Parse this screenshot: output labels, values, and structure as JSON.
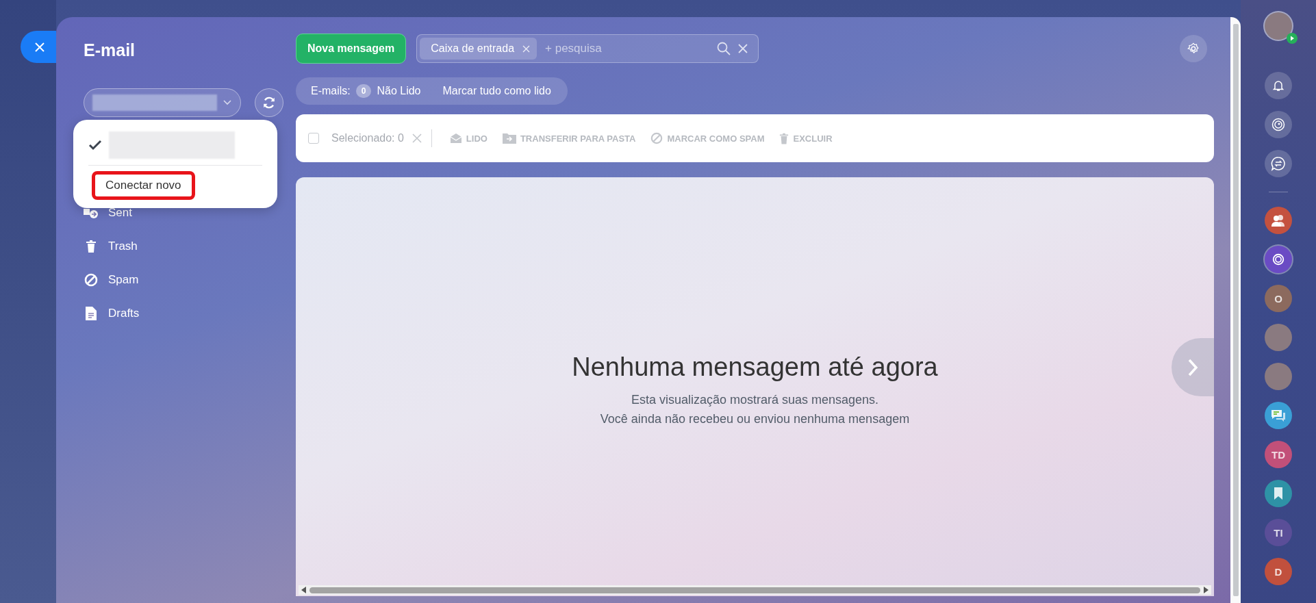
{
  "sidebar": {
    "title": "E-mail",
    "account_menu": [
      {
        "kind": "account",
        "checked": true
      },
      {
        "kind": "action",
        "label": "Conectar novo",
        "highlighted": true
      }
    ],
    "folders": [
      {
        "kind": "sent",
        "label": "Sent"
      },
      {
        "kind": "trash",
        "label": "Trash"
      },
      {
        "kind": "spam",
        "label": "Spam"
      },
      {
        "kind": "drafts",
        "label": "Drafts"
      }
    ]
  },
  "toolbar": {
    "new_button": "Nova mensagem",
    "search": {
      "chip": "Caixa de entrada",
      "placeholder": "+ pesquisa"
    }
  },
  "counters": {
    "label": "E-mails:",
    "count": "0",
    "count_label": "Não Lido",
    "mark_all": "Marcar tudo como lido"
  },
  "actions": {
    "checked": false,
    "selected_label": "Selecionado: 0",
    "items": [
      {
        "kind": "read",
        "label": "LIDO"
      },
      {
        "kind": "move",
        "label": "TRANSFERIR PARA PASTA"
      },
      {
        "kind": "spam",
        "label": "MARCAR COMO SPAM"
      },
      {
        "kind": "delete",
        "label": "EXCLUIR"
      }
    ]
  },
  "empty_state": {
    "title": "Nenhuma mensagem até agora",
    "lines": [
      "Esta visualização mostrará suas mensagens.",
      "Você ainda não recebeu ou enviou nenhuma mensagem"
    ]
  },
  "right_rail": [
    {
      "kind": "profile"
    },
    {
      "kind": "bell"
    },
    {
      "kind": "copilot"
    },
    {
      "kind": "chat-switch"
    },
    {
      "kind": "divider"
    },
    {
      "kind": "group",
      "color": "#c4513f"
    },
    {
      "kind": "copilot-chat",
      "color": "#6a4bc4"
    },
    {
      "kind": "initials",
      "label": "O",
      "color": "#8c6a5e"
    },
    {
      "kind": "photo"
    },
    {
      "kind": "photo"
    },
    {
      "kind": "messages",
      "color": "#3a9fd6"
    },
    {
      "kind": "initials",
      "label": "TD",
      "color": "#c25079"
    },
    {
      "kind": "bookmark",
      "color": "#2e92a6"
    },
    {
      "kind": "initials",
      "label": "TI",
      "color": "#5a4e98"
    },
    {
      "kind": "initials",
      "label": "D",
      "color": "#c1503d"
    }
  ]
}
